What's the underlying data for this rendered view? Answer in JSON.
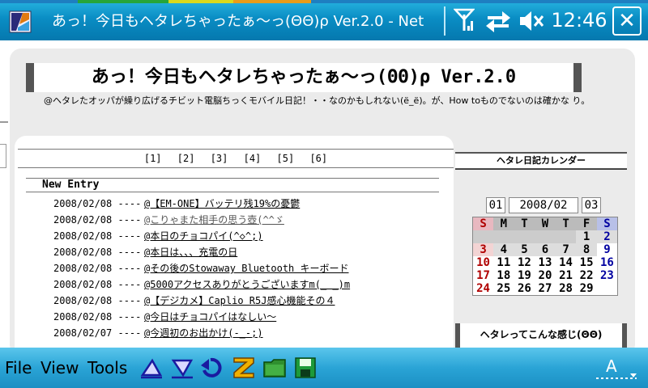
{
  "titlebar": {
    "title": "あっ！今日もヘタレちゃったぁ～っ(ΘΘ)ρ  Ver.2.0  - Net",
    "clock": "12:46",
    "close_label": "✕"
  },
  "page": {
    "site_title": "あっ！今日もヘタレちゃったぁ～っ(ΘΘ)ρ Ver.2.0",
    "description": "@ヘタレたオッパが繰り広げるチビット電脳ちっくモバイル日記！・・なのかもしれない(ё_ё)。が、How toものでないのは確かな り。",
    "page_links": [
      "[1]",
      "[2]",
      "[3]",
      "[4]",
      "[5]",
      "[6]"
    ],
    "new_entry_heading": "New Entry",
    "entries": [
      {
        "date": "2008/02/08 ----",
        "title": "@【EM-ONE】バッテリ残19%の憂鬱",
        "visited": false
      },
      {
        "date": "2008/02/08 ----",
        "title": "@こりゃまた相手の思う壺(^^ゞ",
        "visited": true
      },
      {
        "date": "2008/02/08 ----",
        "title": "@本日のチョコパイ(^◇^;)",
        "visited": false
      },
      {
        "date": "2008/02/08 ----",
        "title": "@本日は、、、充電の日",
        "visited": false
      },
      {
        "date": "2008/02/08 ----",
        "title": "@その後のStowaway Bluetooth キーボード",
        "visited": false
      },
      {
        "date": "2008/02/08 ----",
        "title": "@5000アクセスありがとうございますm(_ _)m",
        "visited": false
      },
      {
        "date": "2008/02/08 ----",
        "title": "@【デジカメ】Caplio R5J感心機能その４",
        "visited": false
      },
      {
        "date": "2008/02/08 ----",
        "title": "@今日はチョコパイはなしい～",
        "visited": false
      },
      {
        "date": "2008/02/07 ----",
        "title": "@今週初のお出かけ(-_-;)",
        "visited": false
      }
    ],
    "calendar": {
      "heading": "ヘタレ日記カレンダー",
      "prev": "01",
      "current": "2008/02",
      "next": "03",
      "weekdays": [
        "S",
        "M",
        "T",
        "W",
        "T",
        "F",
        "S"
      ],
      "weeks": [
        [
          "",
          "",
          "",
          "",
          "",
          "1",
          "2"
        ],
        [
          "3",
          "4",
          "5",
          "6",
          "7",
          "8",
          "9"
        ],
        [
          "10",
          "11",
          "12",
          "13",
          "14",
          "15",
          "16"
        ],
        [
          "17",
          "18",
          "19",
          "20",
          "21",
          "22",
          "23"
        ],
        [
          "24",
          "25",
          "26",
          "27",
          "28",
          "29",
          ""
        ]
      ]
    },
    "about_heading": "ヘタレってこんな感じ(ΘΘ)"
  },
  "toolbar": {
    "file": "File",
    "view": "View",
    "tools": "Tools",
    "icons": [
      "prev-page-icon",
      "next-page-icon",
      "back-icon",
      "zoom-icon",
      "favorites-folder-icon",
      "save-icon",
      "input-method-icon"
    ]
  },
  "colors": {
    "titlebar": "#0a8dc4",
    "toolbar": "#2aa4d6",
    "page_background": "#ebebeb",
    "sunday": "#b00000",
    "saturday": "#0000a0"
  }
}
